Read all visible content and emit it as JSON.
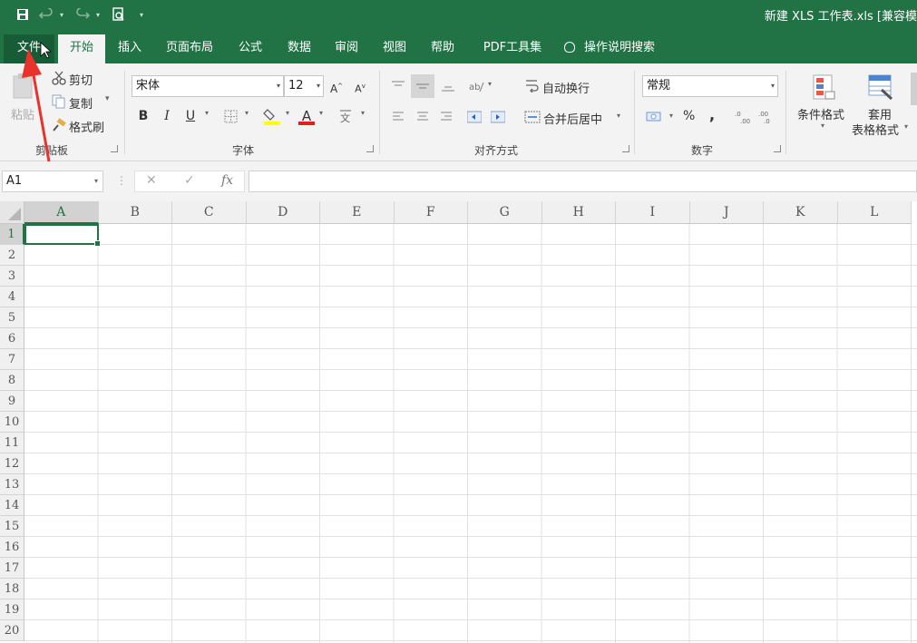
{
  "app": {
    "doc_title": "新建 XLS 工作表.xls  [兼容模"
  },
  "quick_access": {
    "icons": [
      "save-icon",
      "undo-icon",
      "redo-icon",
      "print-preview-icon",
      "customize-icon"
    ]
  },
  "tabs": [
    {
      "label": "文件"
    },
    {
      "label": "开始"
    },
    {
      "label": "插入"
    },
    {
      "label": "页面布局"
    },
    {
      "label": "公式"
    },
    {
      "label": "数据"
    },
    {
      "label": "审阅"
    },
    {
      "label": "视图"
    },
    {
      "label": "帮助"
    },
    {
      "label": "PDF工具集"
    },
    {
      "label": "操作说明搜索"
    }
  ],
  "clipboard": {
    "paste": "粘贴",
    "cut": "剪切",
    "copy": "复制",
    "format_painter": "格式刷",
    "label": "剪贴板"
  },
  "font": {
    "name": "宋体",
    "size": "12",
    "grow": "A",
    "shrink": "A",
    "bold": "B",
    "italic": "I",
    "underline": "U",
    "font_color": "A",
    "label": "字体"
  },
  "alignment": {
    "wrap": "自动换行",
    "merge": "合并后居中",
    "label": "对齐方式"
  },
  "number": {
    "format": "常规",
    "percent": "%",
    "comma": ",",
    "label": "数字"
  },
  "styles": {
    "conditional": "条件格式",
    "table_line1": "套用",
    "table_line2": "表格格式"
  },
  "formula_bar": {
    "name_box": "A1",
    "cancel": "✕",
    "enter": "✓",
    "fx": "fx",
    "value": ""
  },
  "sheet": {
    "columns": [
      "A",
      "B",
      "C",
      "D",
      "E",
      "F",
      "G",
      "H",
      "I",
      "J",
      "K",
      "L"
    ],
    "rows": [
      "1",
      "2",
      "3",
      "4",
      "5",
      "6",
      "7",
      "8",
      "9",
      "10",
      "11",
      "12",
      "13",
      "14",
      "15",
      "16",
      "17",
      "18",
      "19",
      "20"
    ],
    "active_cell": "A1"
  },
  "colors": {
    "brand": "#217346",
    "annotation_arrow": "#e8322b"
  }
}
